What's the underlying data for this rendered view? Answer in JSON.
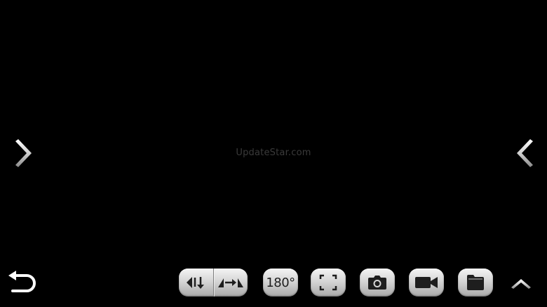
{
  "watermark": {
    "text": "UpdateStar.com"
  },
  "navigation": {
    "prev_icon": "chevron-right-icon",
    "next_icon": "chevron-left-icon",
    "back_icon": "return-arrow-icon",
    "collapse_icon": "chevron-up-icon"
  },
  "toolbar": {
    "flip_vertical_icon": "flip-vertical-icon",
    "flip_horizontal_icon": "flip-horizontal-icon",
    "rotate_label": "180°",
    "fullscreen_icon": "fullscreen-corners-icon",
    "camera_icon": "camera-icon",
    "video_icon": "video-camera-icon",
    "folder_icon": "folder-icon"
  },
  "colors": {
    "background": "#000000",
    "button_light": "#f4f4f4",
    "button_dark": "#a9a9a9",
    "icon": "#1e1e1e",
    "watermark": "#3a3a3a"
  }
}
